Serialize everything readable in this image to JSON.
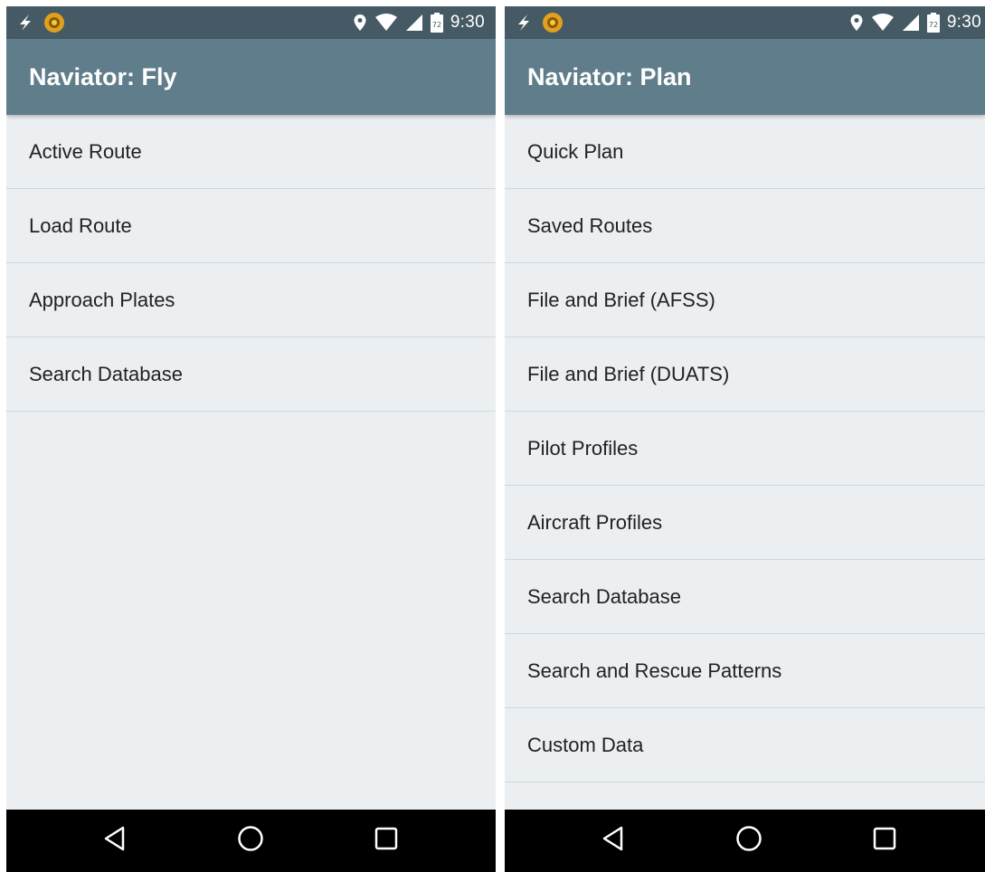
{
  "screens": [
    {
      "status": {
        "time": "9:30",
        "battery_level": "72",
        "icons": [
          "lightning-icon",
          "app-notification-icon",
          "location-pin-icon",
          "wifi-icon",
          "cell-signal-icon",
          "battery-icon"
        ]
      },
      "title": "Naviator: Fly",
      "items": [
        {
          "label": "Active Route"
        },
        {
          "label": "Load Route"
        },
        {
          "label": "Approach Plates"
        },
        {
          "label": "Search Database"
        }
      ]
    },
    {
      "status": {
        "time": "9:30",
        "battery_level": "72",
        "icons": [
          "lightning-icon",
          "app-notification-icon",
          "location-pin-icon",
          "wifi-icon",
          "cell-signal-icon",
          "battery-icon"
        ]
      },
      "title": "Naviator: Plan",
      "items": [
        {
          "label": "Quick Plan"
        },
        {
          "label": "Saved Routes"
        },
        {
          "label": "File and Brief (AFSS)"
        },
        {
          "label": "File and Brief (DUATS)"
        },
        {
          "label": "Pilot Profiles"
        },
        {
          "label": "Aircraft Profiles"
        },
        {
          "label": "Search Database"
        },
        {
          "label": "Search and Rescue Patterns"
        },
        {
          "label": "Custom Data"
        }
      ]
    }
  ],
  "navigation": [
    "back-icon",
    "home-icon",
    "recent-apps-icon"
  ],
  "colors": {
    "status_bar": "#455A64",
    "app_bar": "#607D8B",
    "background": "#ECEFF1",
    "divider": "#CFD8DC",
    "nav_bar": "#000000",
    "notification_accent": "#F5A623"
  }
}
